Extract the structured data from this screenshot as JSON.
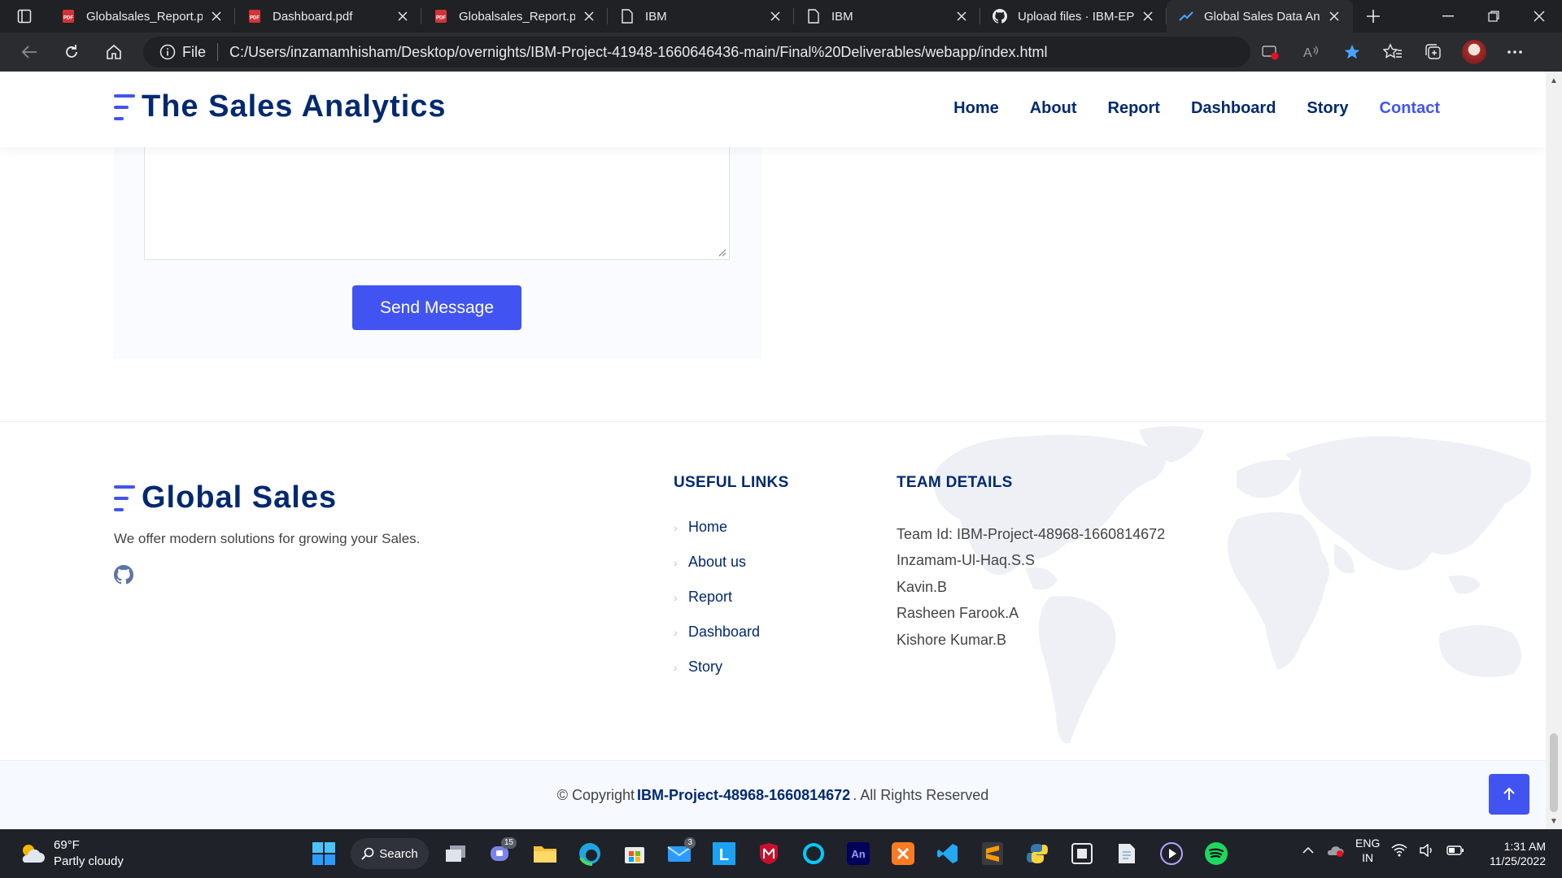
{
  "browser": {
    "tabs": [
      {
        "title": "Globalsales_Report.pdf",
        "icon": "pdf-icon"
      },
      {
        "title": "Dashboard.pdf",
        "icon": "pdf-icon"
      },
      {
        "title": "Globalsales_Report.pdf",
        "icon": "pdf-icon"
      },
      {
        "title": "IBM",
        "icon": "document-icon"
      },
      {
        "title": "IBM",
        "icon": "document-icon"
      },
      {
        "title": "Upload files · IBM-EPBL",
        "icon": "github-icon"
      },
      {
        "title": "Global Sales Data Analytics",
        "icon": "chart-icon",
        "active": true
      }
    ],
    "address": {
      "scheme_label": "File",
      "url": "C:/Users/inzamamhisham/Desktop/overnights/IBM-Project-41948-1660646436-main/Final%20Deliverables/webapp/index.html"
    }
  },
  "site": {
    "brand": "The Sales Analytics",
    "nav": [
      {
        "label": "Home"
      },
      {
        "label": "About"
      },
      {
        "label": "Report"
      },
      {
        "label": "Dashboard"
      },
      {
        "label": "Story"
      },
      {
        "label": "Contact",
        "active": true
      }
    ],
    "contact": {
      "send_label": "Send Message"
    },
    "footer": {
      "brand": "Global Sales",
      "description": "We offer modern solutions for growing your Sales.",
      "links_heading": "USEFUL LINKS",
      "links": [
        "Home",
        "About us",
        "Report",
        "Dashboard",
        "Story"
      ],
      "team_heading": "TEAM DETAILS",
      "team": [
        "Team Id: IBM-Project-48968-1660814672",
        "Inzamam-Ul-Haq.S.S",
        "Kavin.B",
        "Rasheen Farook.A",
        "Kishore Kumar.B"
      ],
      "copyright_prefix": "© Copyright",
      "copyright_strong": "IBM-Project-48968-1660814672",
      "copyright_suffix": ". All Rights Reserved"
    }
  },
  "taskbar": {
    "weather_temp": "69°F",
    "weather_desc": "Partly cloudy",
    "search_label": "Search",
    "lang_1": "ENG",
    "lang_2": "IN",
    "time": "1:31 AM",
    "date": "11/25/2022",
    "badges": {
      "teams": "15",
      "mail": "3"
    }
  },
  "colors": {
    "accent": "#4154f1",
    "navy": "#012970",
    "chrome_dark": "#202124"
  }
}
